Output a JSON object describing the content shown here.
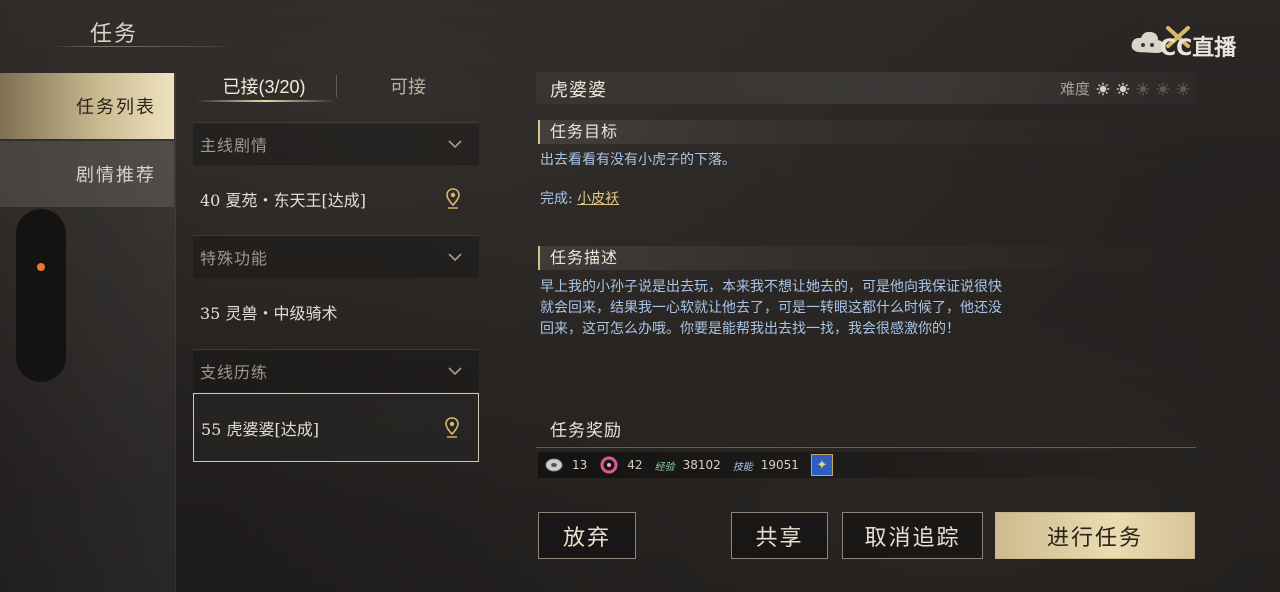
{
  "header": {
    "title": "任务",
    "watermark": "CC直播"
  },
  "sidebar": {
    "tabs": [
      {
        "label": "任务列表",
        "active": true
      },
      {
        "label": "剧情推荐",
        "active": false
      }
    ]
  },
  "quest_list": {
    "tabs": {
      "accepted": "已接(3/20)",
      "available": "可接"
    },
    "categories": [
      {
        "label": "主线剧情",
        "quest": "40 夏苑・东天王[达成]"
      },
      {
        "label": "特殊功能",
        "quest": "35 灵兽・中级骑术"
      },
      {
        "label": "支线历练",
        "quest": "55 虎婆婆[达成]"
      }
    ]
  },
  "detail": {
    "title": "虎婆婆",
    "difficulty_label": "难度",
    "difficulty_level": 2,
    "difficulty_max": 5,
    "objective_head": "任务目标",
    "objective_text": "出去看看有没有小虎子的下落。",
    "complete_label": "完成:",
    "complete_value": "小皮袄",
    "description_head": "任务描述",
    "description_lines": [
      "早上我的小孙子说是出去玩，本来我不想让她去的，可是他向我保证说很快",
      "就会回来，结果我一心软就让他去了，可是一转眼这都什么时候了，他还没",
      "回来，这可怎么办哦。你要是能帮我出去找一找，我会很感激你的！"
    ],
    "reward_head": "任务奖励",
    "rewards": {
      "silver": "13",
      "gem": "42",
      "exp_tag": "经验",
      "exp": "38102",
      "skill_tag": "技能",
      "skill": "19051"
    }
  },
  "buttons": {
    "abandon": "放弃",
    "share": "共享",
    "untrack": "取消追踪",
    "proceed": "进行任务"
  },
  "colors": {
    "accent_gold": "#e6d7aa",
    "objective_blue": "#a9c4e6",
    "complete_gold": "#e3c785",
    "alert_orange": "#e8782b"
  }
}
